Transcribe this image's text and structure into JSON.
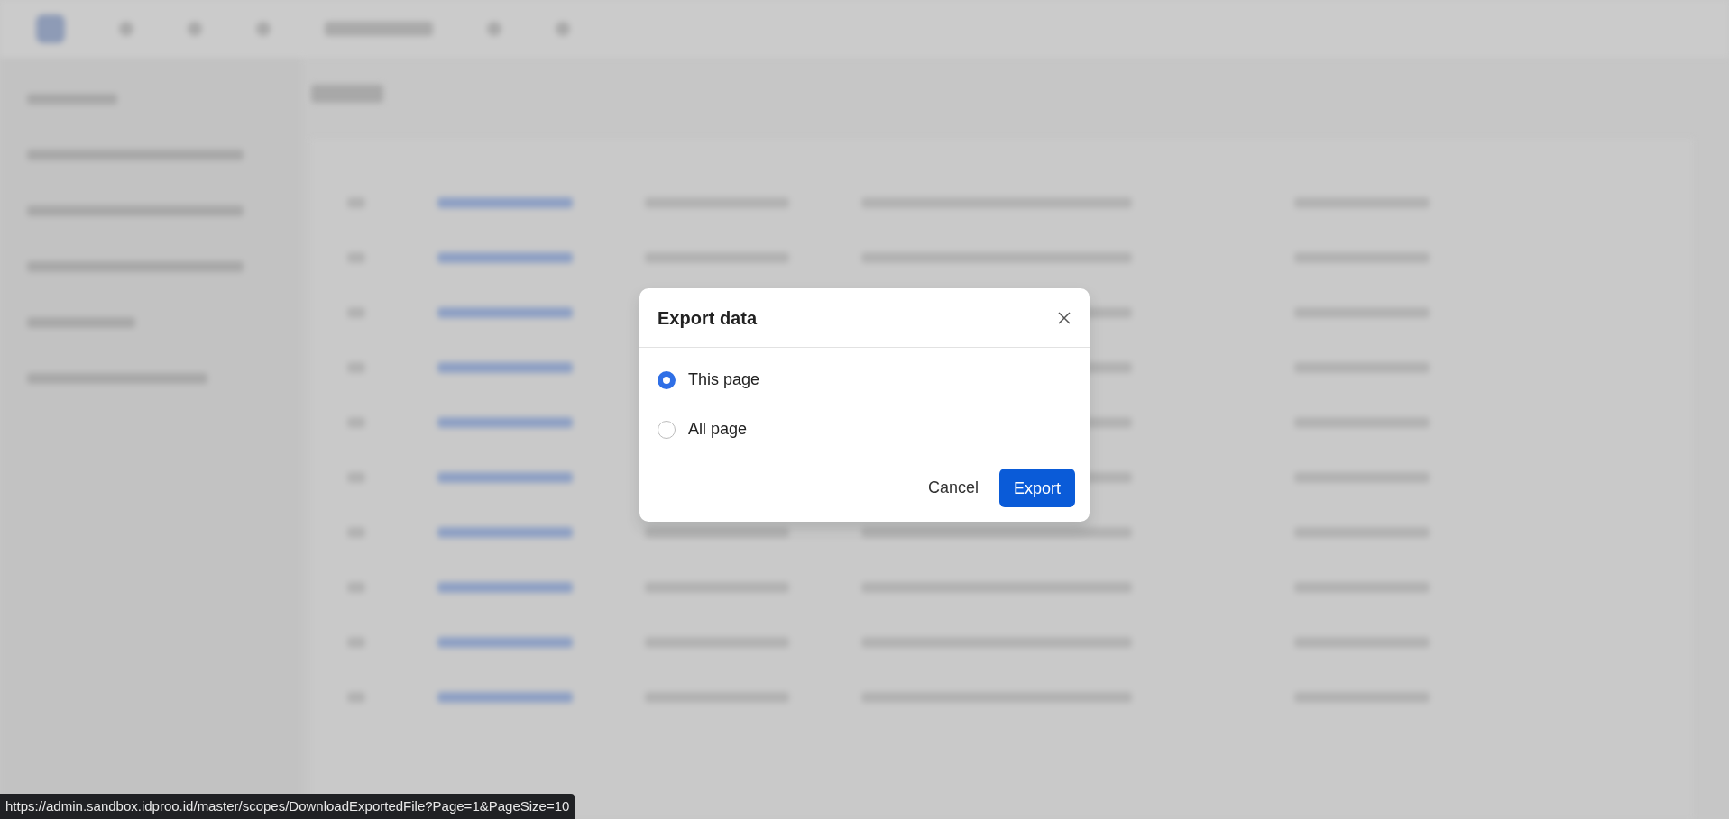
{
  "dialog": {
    "title": "Export data",
    "options": [
      {
        "label": "This page",
        "selected": true
      },
      {
        "label": "All page",
        "selected": false
      }
    ],
    "buttons": [
      {
        "label": "Cancel",
        "kind": "secondary"
      },
      {
        "label": "Export",
        "kind": "primary"
      }
    ]
  },
  "status_bar": {
    "url": "https://admin.sandbox.idproo.id/master/scopes/DownloadExportedFile?Page=1&PageSize=10"
  }
}
